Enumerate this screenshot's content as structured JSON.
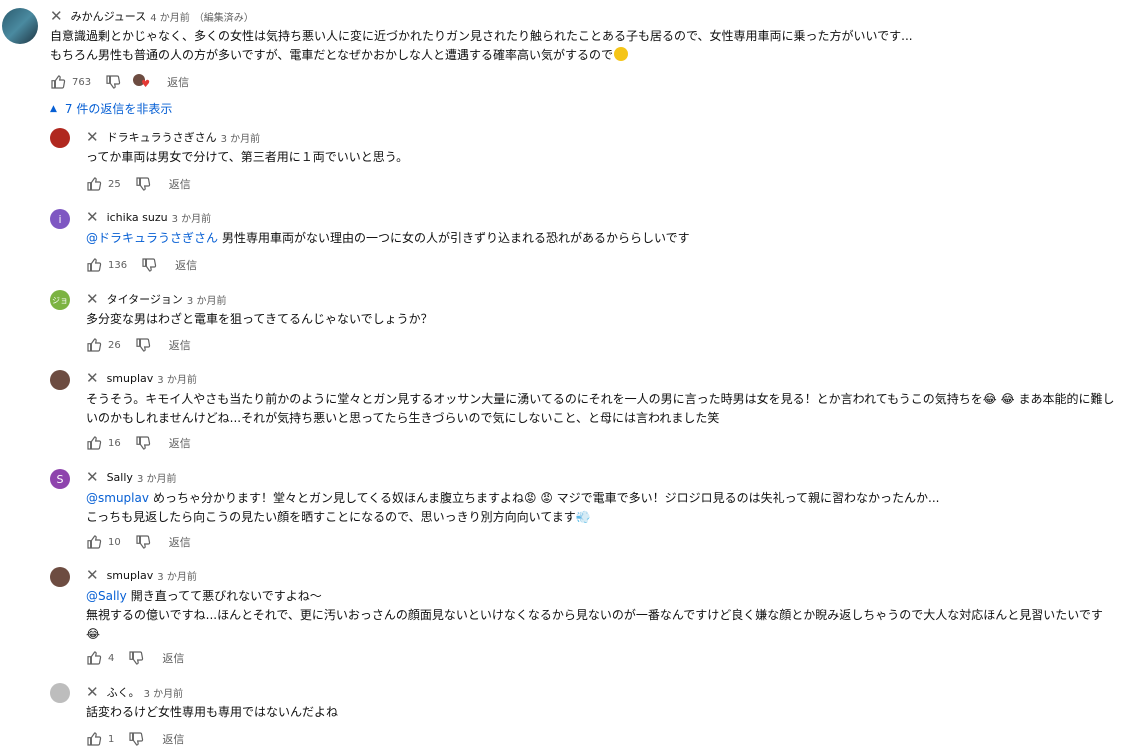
{
  "main_comment": {
    "author": "みかんジュース",
    "time": "4 か月前",
    "edited": "（編集済み）",
    "line1": "自意識過剰とかじゃなく、多くの女性は気持ち悪い人に変に近づかれたりガン見されたり触られたことある子も居るので、女性専用車両に乗った方がいいです...",
    "line2": "もちろん男性も普通の人の方が多いですが、電車だとなぜかおかしな人と遭遇する確率高い気がするので",
    "likes": "763",
    "reply_label": "返信"
  },
  "toggle_label": "7 件の返信を非表示",
  "replies": [
    {
      "author": "ドラキュラうさぎさん",
      "time": "3 か月前",
      "mention": "",
      "text": "ってか車両は男女で分けて、第三者用に１両でいいと思う。",
      "likes": "25",
      "avatar_letter": "",
      "avatar_color": "#b0281f"
    },
    {
      "author": "ichika suzu",
      "time": "3 か月前",
      "mention": "@ドラキュラうさぎさん",
      "text": "男性専用車両がない理由の一つに女の人が引きずり込まれる恐れがあるかららしいです",
      "likes": "136",
      "avatar_letter": "i",
      "avatar_color": "#7e57c2"
    },
    {
      "author": "タイタージョン",
      "time": "3 か月前",
      "mention": "",
      "text": "多分変な男はわざと電車を狙ってきてるんじゃないでしょうか？",
      "likes": "26",
      "avatar_letter": "ジョ",
      "avatar_color": "#7cb342"
    },
    {
      "author": "smuplav",
      "time": "3 か月前",
      "mention": "",
      "text": "そうそう。キモイ人やさも当たり前かのように堂々とガン見するオッサン大量に湧いてるのにそれを一人の男に言った時男は女を見る！とか言われてもうこの気持ちを😂 😂 まあ本能的に難しいのかもしれませんけどね...それが気持ち悪いと思ってたら生きづらいので気にしないこと、と母には言われました笑",
      "likes": "16",
      "avatar_letter": "",
      "avatar_color": "#6d4c41"
    },
    {
      "author": "Sally",
      "time": "3 か月前",
      "mention": "@smuplav",
      "text": "めっちゃ分かります！堂々とガン見してくる奴ほんま腹立ちますよね😡 😡 マジで電車で多い！ジロジロ見るのは失礼って親に習わなかったんか...\nこっちも見返したら向こうの見たい顔を晒すことになるので、思いっきり別方向向いてます💨",
      "likes": "10",
      "avatar_letter": "S",
      "avatar_color": "#8e44ad"
    },
    {
      "author": "smuplav",
      "time": "3 か月前",
      "mention": "@Sally",
      "text": "開き直ってて悪びれないですよね〜\n無視するの億いですね...ほんとそれで、更に汚いおっさんの顔面見ないといけなくなるから見ないのが一番なんですけど良く嫌な顔とか睨み返しちゃうので大人な対応ほんと見習いたいです😂",
      "likes": "4",
      "avatar_letter": "",
      "avatar_color": "#6d4c41"
    },
    {
      "author": "ふく。",
      "time": "3 か月前",
      "mention": "",
      "text": "話変わるけど女性専用も専用ではないんだよね",
      "likes": "1",
      "avatar_letter": "",
      "avatar_color": "#bdbdbd"
    }
  ]
}
